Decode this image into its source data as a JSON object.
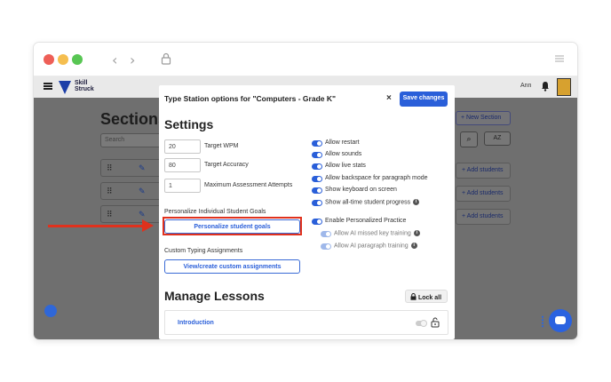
{
  "browser": {
    "back_glyph": "‹",
    "forward_glyph": "›",
    "icons": [
      "lock-icon",
      "tab-menu-icon"
    ]
  },
  "appbar": {
    "logo_line1": "Skill",
    "logo_line2": "Struck",
    "user_name": "Ann",
    "icons": [
      "hamburger-icon",
      "bell-icon",
      "avatar"
    ]
  },
  "background": {
    "title": "Sections",
    "search_placeholder": "Search",
    "new_section": "+ New Section",
    "az_label": "AZ",
    "add_students": "+ Add students",
    "row_grip": "⠿",
    "row_pen": "✎",
    "search_glyph": "⌕"
  },
  "modal": {
    "title": "Type Station options for \"Computers - Grade K\"",
    "close_glyph": "×",
    "save_label": "Save changes",
    "settings_heading": "Settings",
    "inputs": [
      {
        "value": "20",
        "label": "Target WPM"
      },
      {
        "value": "80",
        "label": "Target Accuracy"
      },
      {
        "value": "1",
        "label": "Maximum Assessment Attempts"
      }
    ],
    "personalize_label": "Personalize Individual Student Goals",
    "personalize_button": "Personalize student goals",
    "custom_label": "Custom Typing Assignments",
    "custom_button": "View/create custom assignments",
    "toggles": [
      {
        "label": "Allow restart",
        "on": true
      },
      {
        "label": "Allow sounds",
        "on": true
      },
      {
        "label": "Allow live stats",
        "on": true
      },
      {
        "label": "Allow backspace for paragraph mode",
        "on": true
      },
      {
        "label": "Show keyboard on screen",
        "on": true
      },
      {
        "label": "Show all-time student progress",
        "on": true,
        "info": true
      }
    ],
    "personalized_practice": {
      "label": "Enable Personalized Practice",
      "sub": [
        {
          "label": "Allow AI missed key training",
          "info": true
        },
        {
          "label": "Allow AI paragraph training",
          "info": true
        }
      ]
    },
    "info_glyph": "i",
    "manage_heading": "Manage Lessons",
    "lock_all": "Lock all",
    "lessons": [
      {
        "name": "Introduction"
      }
    ]
  },
  "colors": {
    "accent": "#2a5fd9",
    "annotation": "#e0311d"
  }
}
